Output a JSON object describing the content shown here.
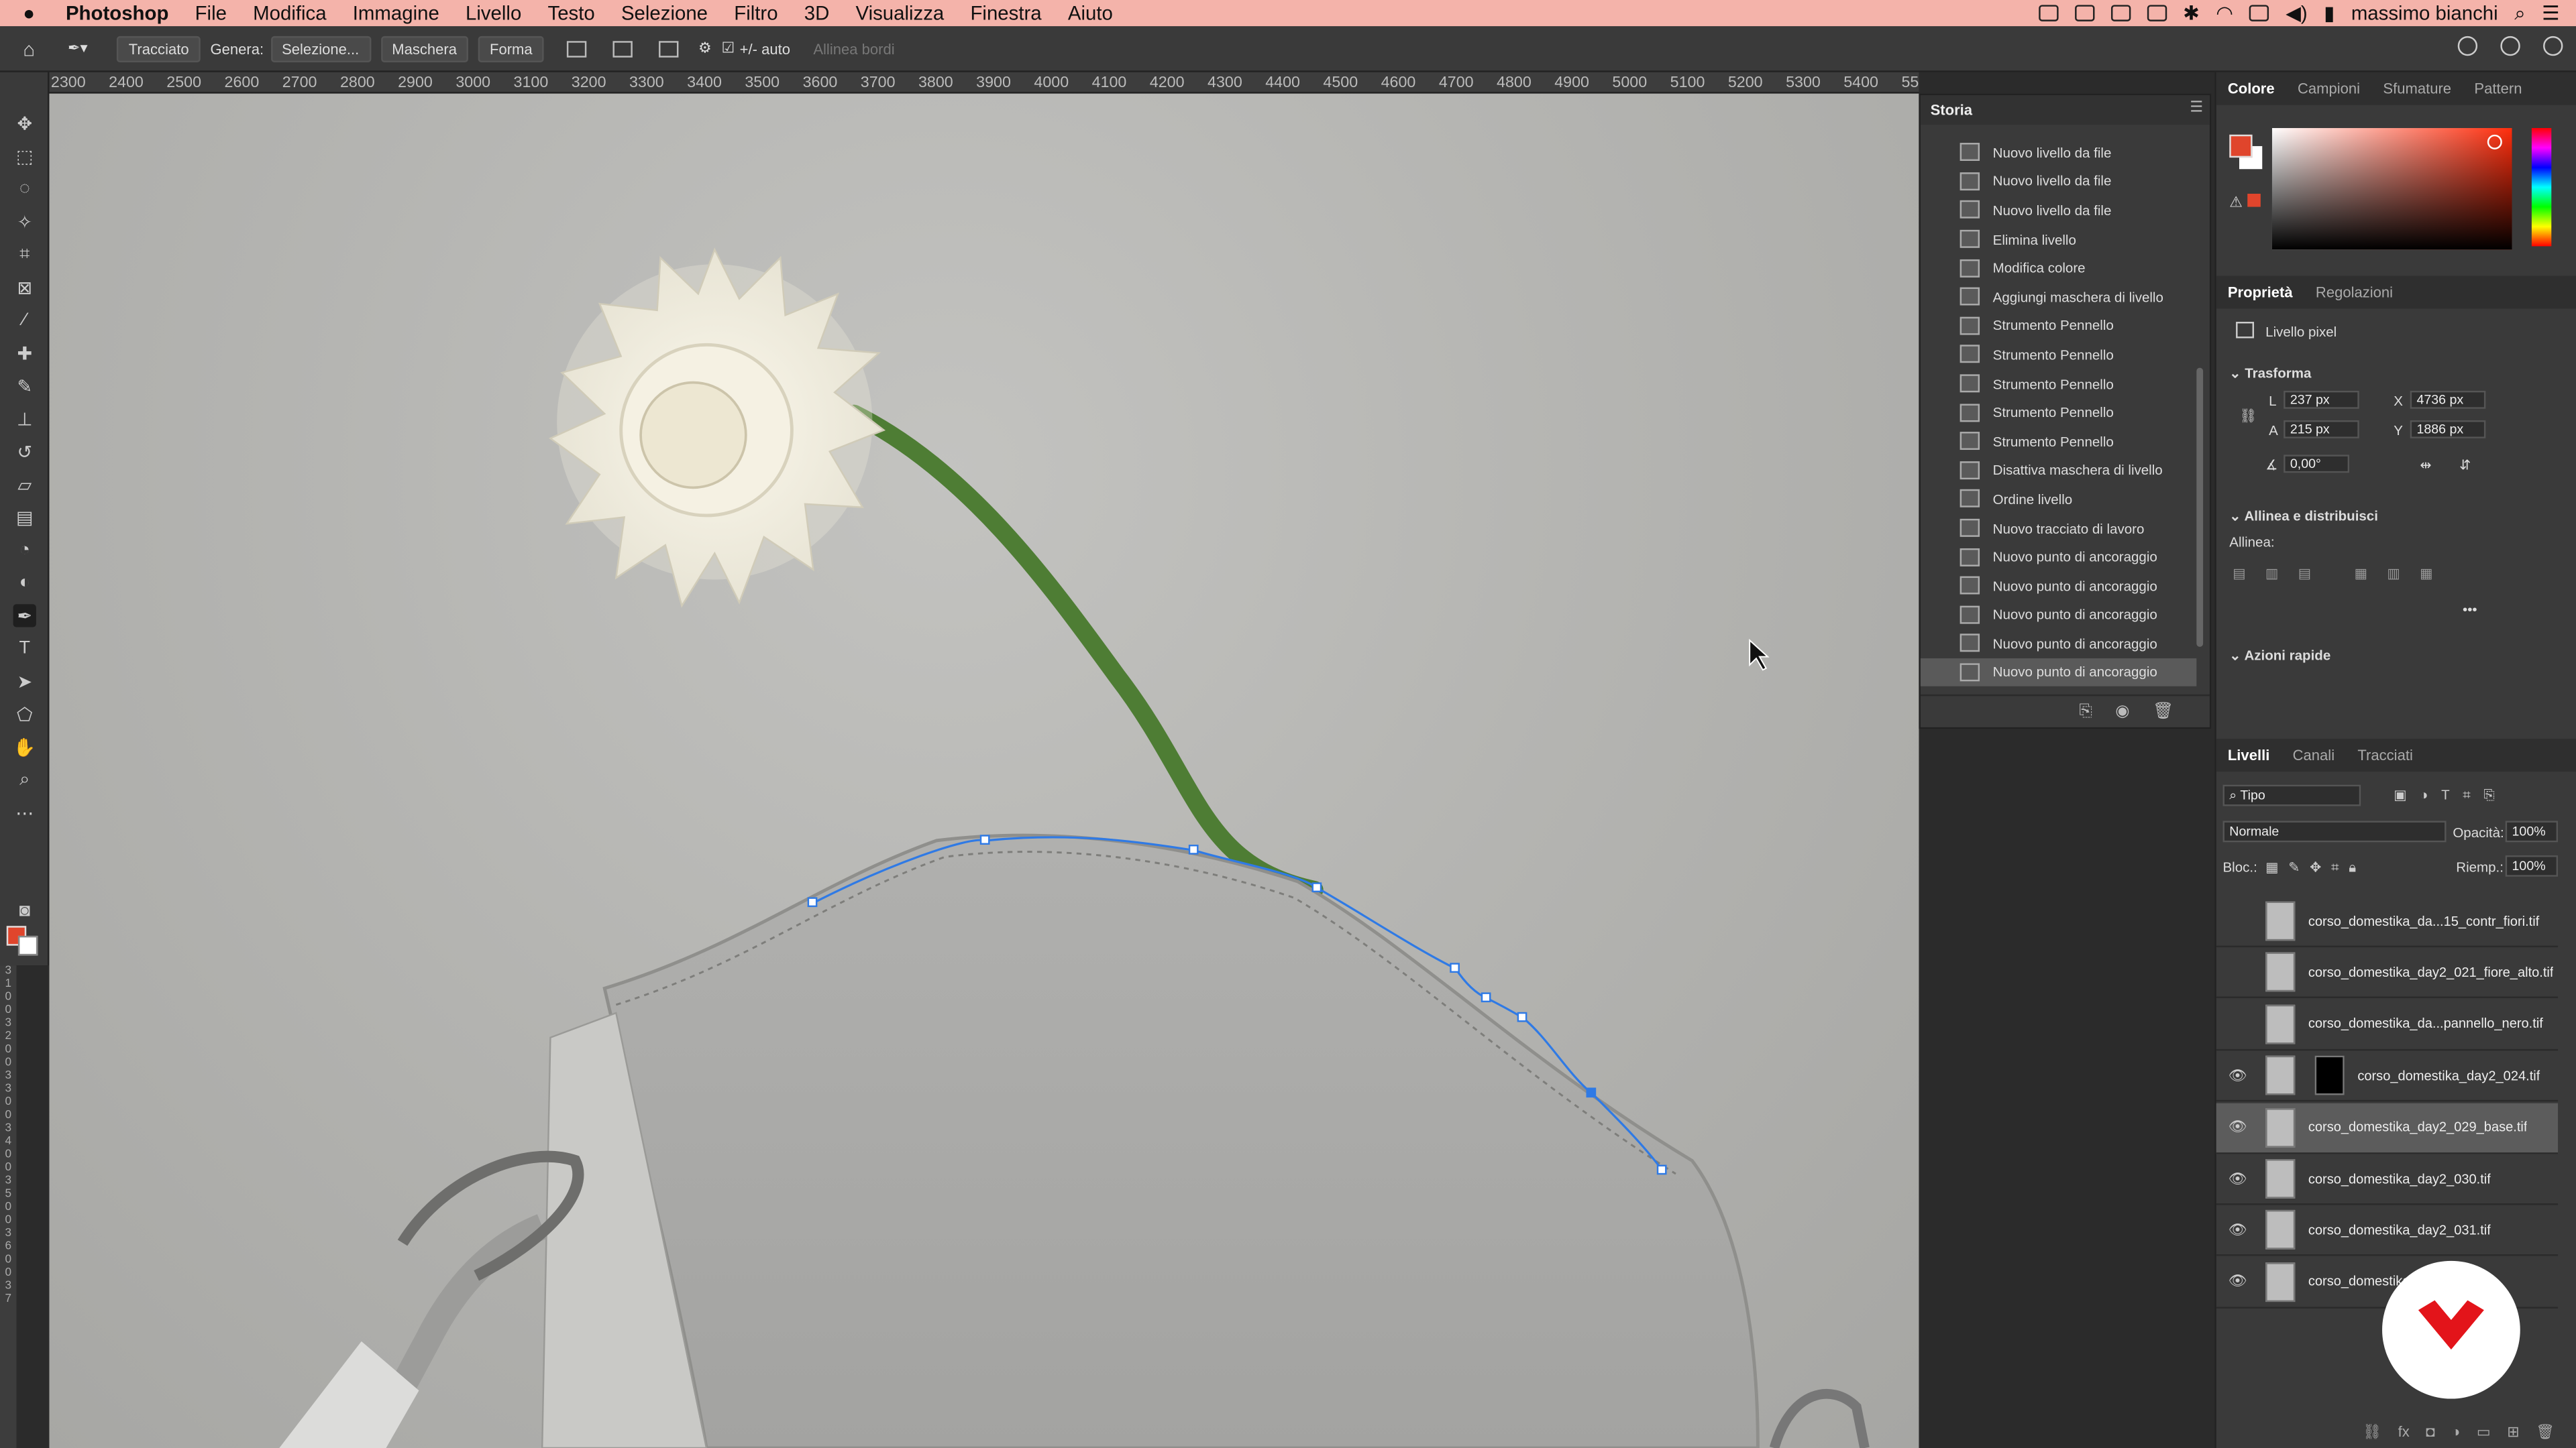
{
  "menubar": {
    "app": "Photoshop",
    "items": [
      "File",
      "Modifica",
      "Immagine",
      "Livello",
      "Testo",
      "Selezione",
      "Filtro",
      "3D",
      "Visualizza",
      "Finestra",
      "Aiuto"
    ],
    "user": "massimo bianchi"
  },
  "options": {
    "mode": "Tracciato",
    "genera_label": "Genera:",
    "selection_button": "Selezione...",
    "mask_button": "Maschera",
    "shape_button": "Forma",
    "auto_label": "+/- auto",
    "align_edges": "Allinea bordi"
  },
  "ruler_h": [
    "2300",
    "2400",
    "2500",
    "2600",
    "2700",
    "2800",
    "2900",
    "3000",
    "3100",
    "3200",
    "3300",
    "3400",
    "3500",
    "3600",
    "3700",
    "3800",
    "3900",
    "4000",
    "4100",
    "4200",
    "4300",
    "4400",
    "4500",
    "4600",
    "4700",
    "4800",
    "4900",
    "5000",
    "5100",
    "5200",
    "5300",
    "5400",
    "55"
  ],
  "ruler_v": [
    "3",
    "1",
    "0",
    "0",
    "3",
    "2",
    "0",
    "0",
    "3",
    "3",
    "0",
    "0",
    "3",
    "4",
    "0",
    "0",
    "3",
    "5",
    "0",
    "0",
    "3",
    "6",
    "0",
    "0",
    "3",
    "7"
  ],
  "history": {
    "title": "Storia",
    "items": [
      "Nuovo livello da file",
      "Nuovo livello da file",
      "Nuovo livello da file",
      "Elimina livello",
      "Modifica colore",
      "Aggiungi maschera di livello",
      "Strumento Pennello",
      "Strumento Pennello",
      "Strumento Pennello",
      "Strumento Pennello",
      "Strumento Pennello",
      "Disattiva maschera di livello",
      "Ordine livello",
      "Nuovo tracciato di lavoro",
      "Nuovo punto di ancoraggio",
      "Nuovo punto di ancoraggio",
      "Nuovo punto di ancoraggio",
      "Nuovo punto di ancoraggio",
      "Nuovo punto di ancoraggio"
    ],
    "selected_index": 18
  },
  "color_tabs": [
    "Colore",
    "Campioni",
    "Sfumature",
    "Pattern"
  ],
  "props_tabs": [
    "Proprietà",
    "Regolazioni"
  ],
  "props": {
    "layer_type": "Livello pixel",
    "transform_title": "Trasforma",
    "L_label": "L",
    "L": "237 px",
    "A_label": "A",
    "A": "215 px",
    "X_label": "X",
    "X": "4736 px",
    "Y_label": "Y",
    "Y": "1886 px",
    "angle": "0,00°",
    "align_title": "Allinea e distribuisci",
    "align_label": "Allinea:",
    "quick_title": "Azioni rapide",
    "more": "•••"
  },
  "layers_tabs": [
    "Livelli",
    "Canali",
    "Tracciati"
  ],
  "layers_panel": {
    "filter": "Tipo",
    "blend": "Normale",
    "opacity_label": "Opacità:",
    "opacity": "100%",
    "lock_label": "Bloc.:",
    "fill_label": "Riemp.:",
    "fill": "100%"
  },
  "layers": [
    {
      "name": "corso_domestika_da...15_contr_fiori.tif",
      "visible": false
    },
    {
      "name": "corso_domestika_day2_021_fiore_alto.tif",
      "visible": false
    },
    {
      "name": "corso_domestika_da...pannello_nero.tif",
      "visible": false
    },
    {
      "name": "corso_domestika_day2_024.tif",
      "visible": true,
      "mask": true
    },
    {
      "name": "corso_domestika_day2_029_base.tif",
      "visible": true,
      "selected": true
    },
    {
      "name": "corso_domestika_day2_030.tif",
      "visible": true
    },
    {
      "name": "corso_domestika_day2_031.tif",
      "visible": true
    },
    {
      "name": "corso_domestika",
      "visible": true
    }
  ],
  "colors": {
    "foreground": "#e0452c",
    "accent": "#1473e6",
    "menubar": "#f4b3aa",
    "path": "#2f7ae5"
  }
}
